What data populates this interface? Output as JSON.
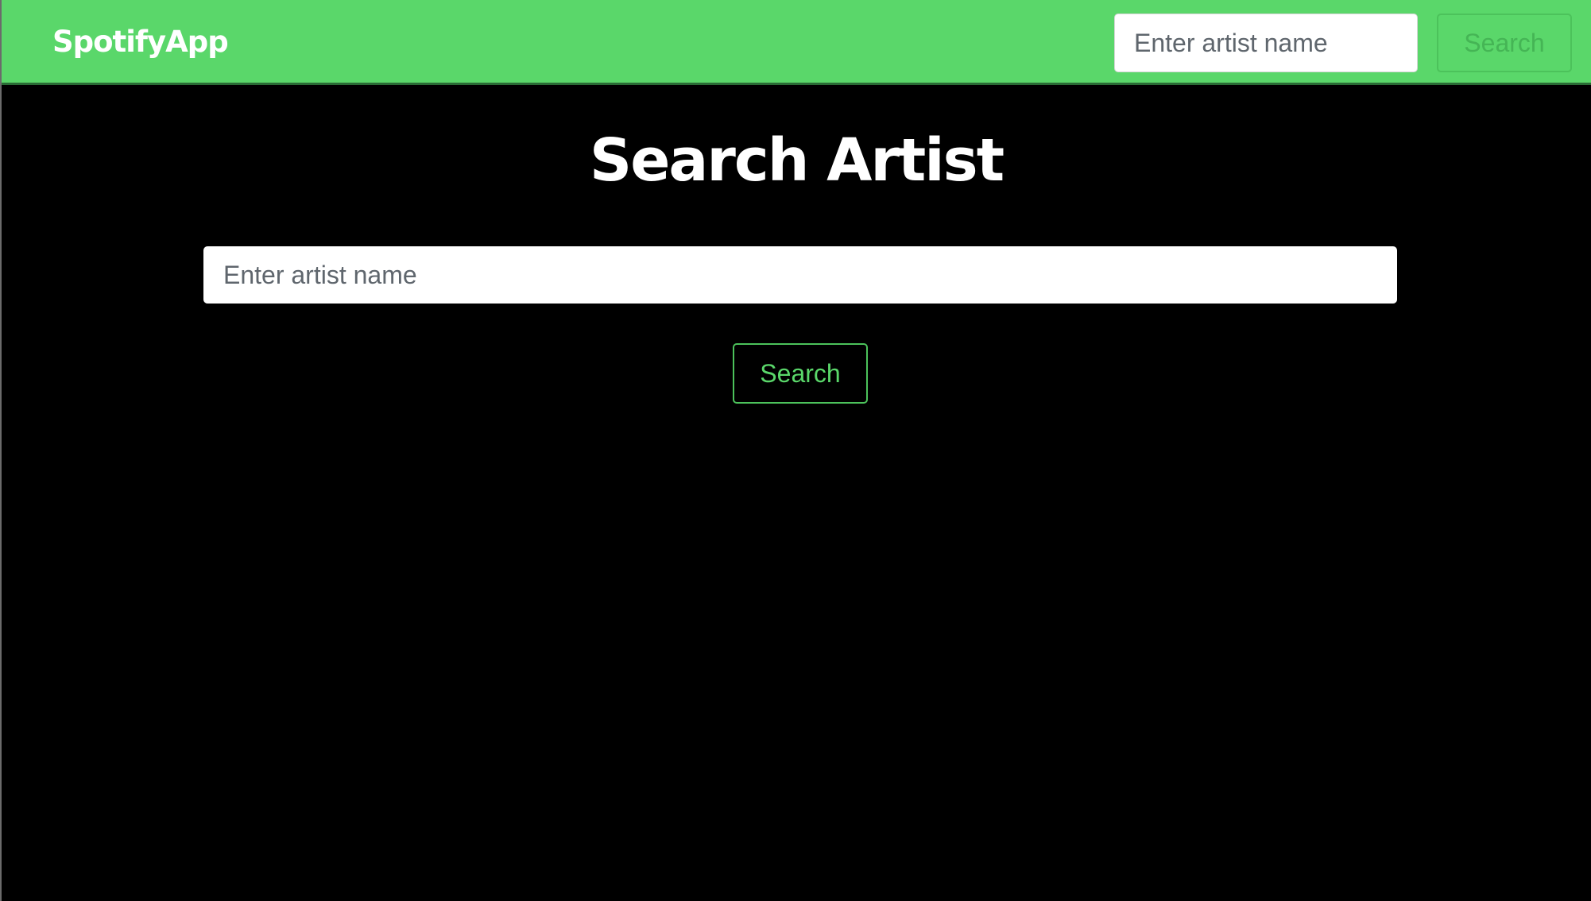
{
  "navbar": {
    "brand": "SpotifyApp",
    "search_placeholder": "Enter artist name",
    "search_button_label": "Search"
  },
  "main": {
    "title": "Search Artist",
    "search_placeholder": "Enter artist name",
    "search_button_label": "Search"
  },
  "colors": {
    "accent": "#5ad76a",
    "background": "#000000",
    "text_light": "#ffffff"
  }
}
